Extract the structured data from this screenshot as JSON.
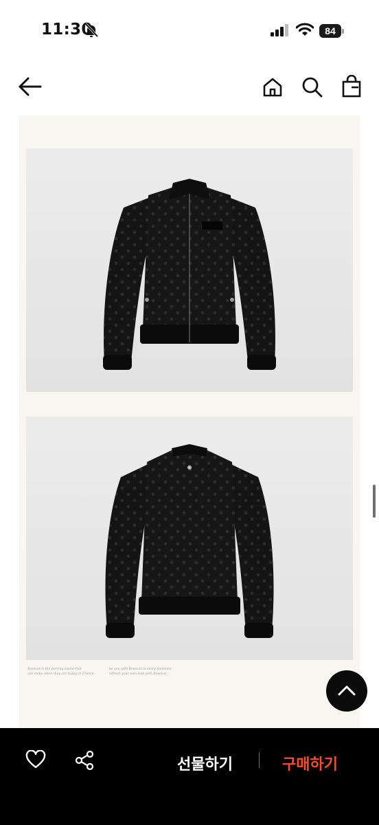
{
  "status_bar": {
    "time": "11:30",
    "battery": "84",
    "icons": [
      "bell-off-icon",
      "cellular-signal-icon",
      "wifi-icon",
      "battery-icon"
    ]
  },
  "nav": {
    "icons": [
      "back-arrow-icon",
      "home-icon",
      "search-icon",
      "shopping-bag-icon"
    ]
  },
  "product_images": [
    {
      "view": "front",
      "subject": "black quilted monogram bomber jacket"
    },
    {
      "view": "back",
      "subject": "black quilted monogram bomber jacket"
    }
  ],
  "captions": {
    "left": [
      "Rosevos is the purring sound that",
      "can make when they are happy in France."
    ],
    "right": [
      "be you with Rosevos in every moments",
      "refresh your own look with Rosevos."
    ]
  },
  "actions": {
    "gift_label": "선물하기",
    "buy_label": "구매하기",
    "icons": [
      "heart-icon",
      "share-icon",
      "chevron-up-icon"
    ]
  },
  "colors": {
    "accent": "#ff4a2a",
    "bottom_bar": "#000000",
    "content_bg": "#f7f6f1"
  }
}
